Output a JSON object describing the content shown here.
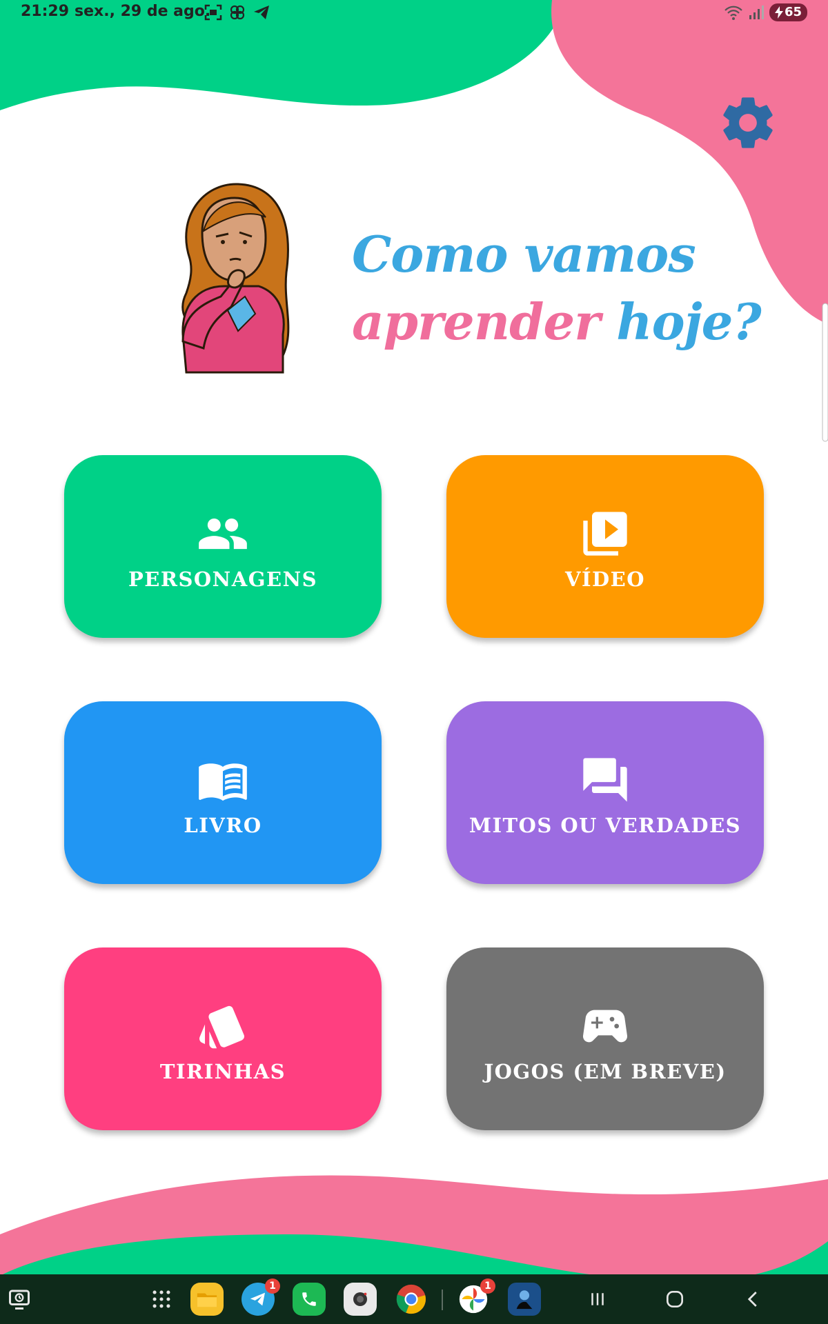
{
  "status_bar": {
    "time": "21:29",
    "date": "sex., 29 de ago.",
    "battery": "65"
  },
  "header": {
    "title_line1_part1": "Como vamos",
    "title_line2_part1": "aprender",
    "title_line2_part2": "hoje?"
  },
  "menu": {
    "personagens": "PERSONAGENS",
    "video": "VÍDEO",
    "livro": "LIVRO",
    "mitos": "MITOS OU VERDADES",
    "tirinhas": "TIRINHAS",
    "jogos": "JOGOS (EM BREVE)"
  },
  "dock": {
    "telegram_badge": "1",
    "photos_badge": "1"
  },
  "colors": {
    "green": "#00d187",
    "orange": "#ff9a00",
    "blue": "#2196f3",
    "purple": "#9c6ce1",
    "pink": "#ff3f80",
    "gray": "#737373",
    "title_blue": "#3ba7e0",
    "title_pink": "#f06e9c",
    "gear": "#2f6aa3"
  },
  "icons": [
    "settings-gear-icon",
    "people-icon",
    "video-library-icon",
    "book-icon",
    "forum-icon",
    "cards-icon",
    "gamepad-icon"
  ]
}
